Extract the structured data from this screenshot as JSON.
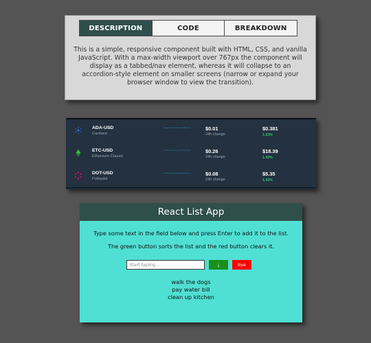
{
  "tabs_card": {
    "tabs": [
      {
        "label": "DESCRIPTION",
        "active": true
      },
      {
        "label": "CODE",
        "active": false
      },
      {
        "label": "BREAKDOWN",
        "active": false
      }
    ],
    "description": "This is a simple, responsive component built with HTML, CSS, and vanilla JavaScript. With a max-width viewport over 767px the component will display as a tabbed/nav element, whereas it will collapse to an accordion-style element on smaller screens (narrow or expand your browser window to view the transition)."
  },
  "ticker": {
    "rows": [
      {
        "pair": "ADA-USD",
        "name": "Cardano",
        "icon": "cardano-icon",
        "icon_color": "#3468d1",
        "price": "$0.01",
        "price_sub": "24h change",
        "value": "$0.381",
        "change": "1.53%"
      },
      {
        "pair": "ETC-USD",
        "name": "Ethereum Classic",
        "icon": "ethereum-classic-icon",
        "icon_color": "#3ab83a",
        "price": "$0.26",
        "price_sub": "24h change",
        "value": "$18.39",
        "change": "1.43%"
      },
      {
        "pair": "DOT-USD",
        "name": "Polkadot",
        "icon": "polkadot-icon",
        "icon_color": "#e6007a",
        "price": "$0.08",
        "price_sub": "24h change",
        "value": "$5.35",
        "change": "1.43%"
      }
    ],
    "colors": {
      "background": "#1f2a37",
      "positive": "#2ecc71",
      "sparkline": "#2a6f8f"
    }
  },
  "list_app": {
    "title": "React List App",
    "instruction_1": "Type some text in the field below and press Enter to add it to the list.",
    "instruction_2": "The green button sorts the list and the red button clears it.",
    "input_placeholder": "Start typing...",
    "input_value": "",
    "sort_button_label": "↓",
    "clear_button_label": "bye",
    "items": [
      "walk the dogs",
      "pay water bill",
      "clean up kitchen"
    ],
    "colors": {
      "header": "#2f4f4b",
      "body": "#4fe0d3",
      "sort_button": "#1a8f1a",
      "clear_button": "#ff0000"
    }
  }
}
